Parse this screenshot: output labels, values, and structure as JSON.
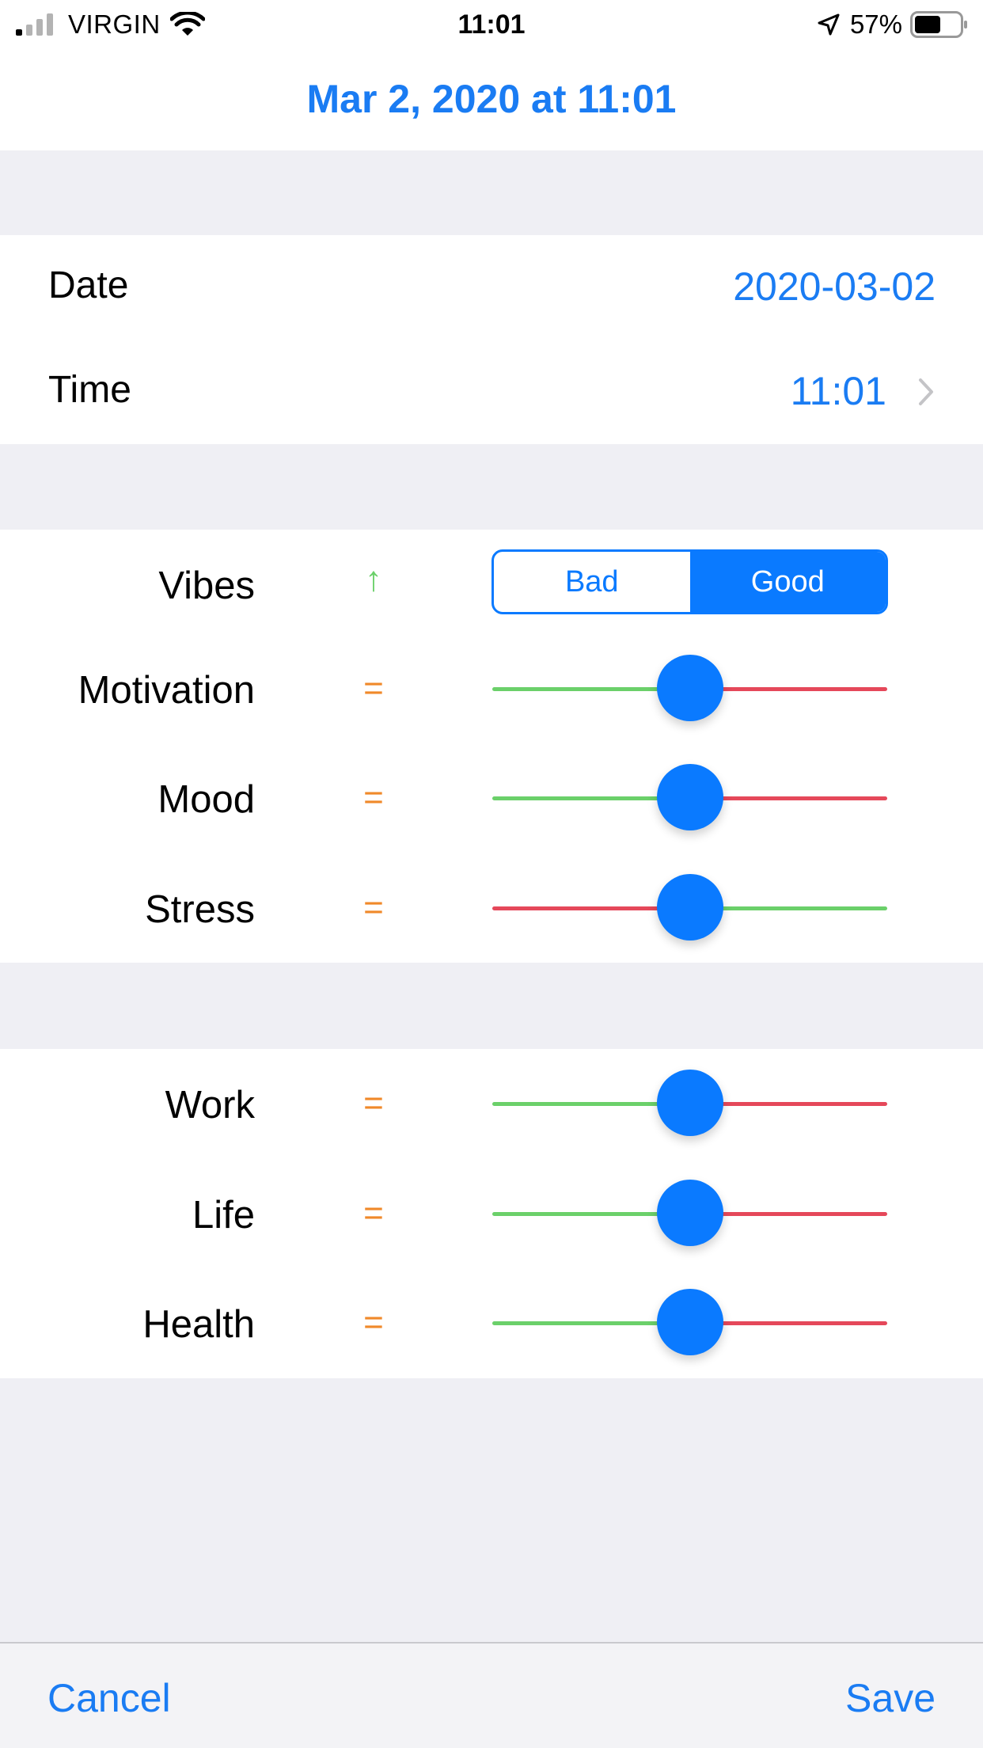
{
  "status_bar": {
    "carrier": "VIRGIN",
    "time": "11:01",
    "battery": "57%"
  },
  "nav": {
    "title": "Mar 2, 2020 at 11:01"
  },
  "datetime": {
    "date_label": "Date",
    "date_value": "2020-03-02",
    "time_label": "Time",
    "time_value": "11:01"
  },
  "feelings": {
    "vibes": {
      "label": "Vibes",
      "trend": "↑",
      "options": [
        "Bad",
        "Good"
      ],
      "selected": "Good"
    },
    "sliders": [
      {
        "label": "Motivation",
        "trend": "=",
        "value": 0.5,
        "left_color": "#6bd06a",
        "right_color": "#e5485a"
      },
      {
        "label": "Mood",
        "trend": "=",
        "value": 0.5,
        "left_color": "#6bd06a",
        "right_color": "#e5485a"
      },
      {
        "label": "Stress",
        "trend": "=",
        "value": 0.5,
        "left_color": "#e5485a",
        "right_color": "#6bd06a"
      }
    ]
  },
  "areas": {
    "sliders": [
      {
        "label": "Work",
        "trend": "=",
        "value": 0.5,
        "left_color": "#6bd06a",
        "right_color": "#e5485a"
      },
      {
        "label": "Life",
        "trend": "=",
        "value": 0.5,
        "left_color": "#6bd06a",
        "right_color": "#e5485a"
      },
      {
        "label": "Health",
        "trend": "=",
        "value": 0.5,
        "left_color": "#6bd06a",
        "right_color": "#e5485a"
      }
    ]
  },
  "toolbar": {
    "cancel_label": "Cancel",
    "save_label": "Save"
  },
  "colors": {
    "accent": "#0a7aff",
    "positive": "#6bd06a",
    "negative": "#e5485a",
    "neutral_trend": "#f0892a"
  },
  "icons": [
    "cellular-signal-icon",
    "wifi-icon",
    "location-arrow-icon",
    "battery-icon",
    "chevron-right-icon",
    "trend-up-icon",
    "trend-equal-icon"
  ]
}
